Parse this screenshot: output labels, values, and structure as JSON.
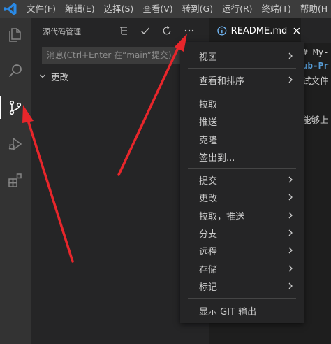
{
  "menubar": {
    "items": [
      "文件(F)",
      "编辑(E)",
      "选择(S)",
      "查看(V)",
      "转到(G)",
      "运行(R)",
      "终端(T)",
      "帮助(H"
    ]
  },
  "activity_bar": {
    "icons": [
      "explorer-icon",
      "search-icon",
      "source-control-icon",
      "run-debug-icon",
      "extensions-icon"
    ],
    "active": "source-control-icon"
  },
  "sidebar": {
    "title": "源代码管理",
    "actions": [
      "view-as-tree-icon",
      "commit-check-icon",
      "refresh-icon",
      "more-actions-icon"
    ],
    "commit_placeholder": "消息(Ctrl+Enter 在“main”提交)",
    "changes_label": "更改"
  },
  "editor": {
    "tab_label": "README.md",
    "lines": [
      "# My-",
      "ub-Pr",
      "试文件",
      "能够上"
    ]
  },
  "context_menu": {
    "items": [
      {
        "label": "视图",
        "submenu": true
      },
      {
        "label": "查看和排序",
        "submenu": true
      },
      {
        "label": "拉取",
        "submenu": false
      },
      {
        "label": "推送",
        "submenu": false
      },
      {
        "label": "克隆",
        "submenu": false
      },
      {
        "label": "签出到...",
        "submenu": false
      },
      {
        "label": "提交",
        "submenu": true
      },
      {
        "label": "更改",
        "submenu": true
      },
      {
        "label": "拉取，推送",
        "submenu": true
      },
      {
        "label": "分支",
        "submenu": true
      },
      {
        "label": "远程",
        "submenu": true
      },
      {
        "label": "存储",
        "submenu": true
      },
      {
        "label": "标记",
        "submenu": true
      },
      {
        "label": "显示 GIT 输出",
        "submenu": false
      }
    ]
  },
  "colors": {
    "accent_blue": "#0e70c0",
    "annotation_red": "#e8262b",
    "code_blue": "#569cd6"
  }
}
